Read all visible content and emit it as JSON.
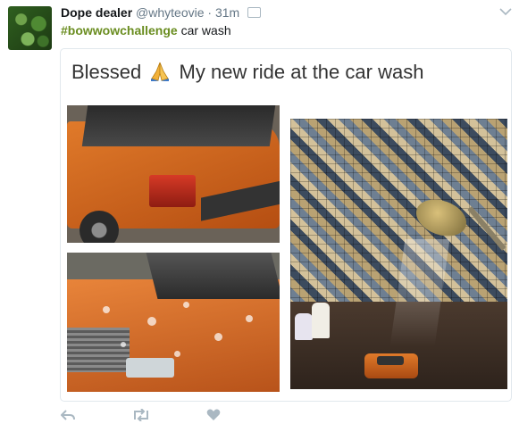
{
  "tweet": {
    "display_name": "Dope dealer",
    "handle": "@whyteovie",
    "separator": "·",
    "time": "31m",
    "hashtag": "#bowwowchallenge",
    "text": " car wash"
  },
  "meme": {
    "caption_before": "Blessed",
    "caption_after": "My new ride at the car wash"
  },
  "icons": {
    "caret": "chevron-down-icon",
    "media": "image-icon",
    "reply": "reply-icon",
    "retweet": "retweet-icon",
    "like": "heart-icon",
    "pray": "praying-hands-emoji"
  },
  "colors": {
    "hashtag": "#6a8d20",
    "muted": "#657786",
    "action": "#aab8c2"
  }
}
